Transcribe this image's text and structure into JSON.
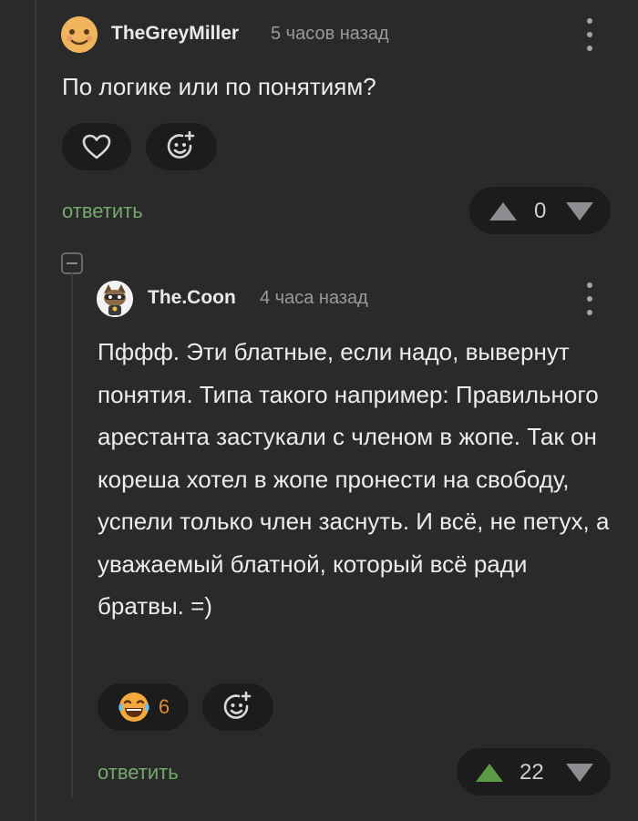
{
  "comments": [
    {
      "username": "TheGreyMiller",
      "time": "5 часов назад",
      "text": "По логике или по понятиям?",
      "reply_label": "ответить",
      "rating": "0"
    },
    {
      "username": "The.Coon",
      "time": "4 часа назад",
      "text": "Пффф. Эти блатные, если надо, вывернут понятия. Типа такого например: Правильного арестанта застукали с членом в жопе. Так он кореша хотел в жопе пронести на свободу, успели только член заснуть. И всё, не петух, а уважаемый блатной, который всё ради братвы. =)",
      "reaction_count": "6",
      "reply_label": "ответить",
      "rating": "22"
    }
  ],
  "colors": {
    "background": "#2a2a2b",
    "pill": "#1c1c1d",
    "reply": "#74a96c",
    "upvote_active": "#5a9a45",
    "reaction_count": "#e08a2e"
  },
  "icons": [
    "avatar",
    "kebab-menu-icon",
    "heart-icon",
    "add-emoji-icon",
    "laughing-emoji-icon",
    "upvote-icon",
    "downvote-icon",
    "collapse-icon"
  ]
}
